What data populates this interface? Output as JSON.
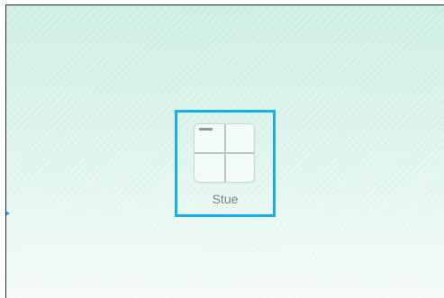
{
  "room": {
    "label": "Stue",
    "icon": "floorplan-grid-icon"
  },
  "colors": {
    "selection_border": "#19aee8",
    "background_top": "#cdeee4",
    "background_bottom": "#f3fbf8",
    "label_text": "#7a7f7e"
  }
}
